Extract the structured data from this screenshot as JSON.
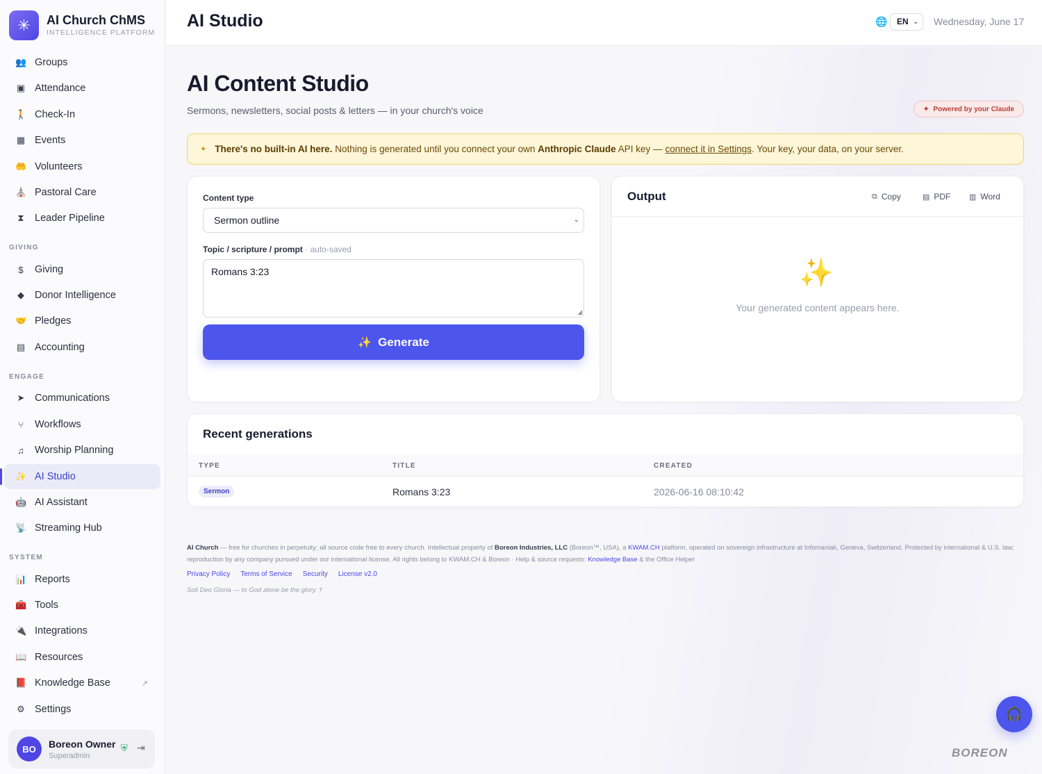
{
  "brand": {
    "name": "AI Church ChMS",
    "subtitle": "INTELLIGENCE PLATFORM"
  },
  "sidebar": {
    "items_top": [
      {
        "label": "Groups",
        "icon": "groups-icon"
      },
      {
        "label": "Attendance",
        "icon": "attendance-icon"
      },
      {
        "label": "Check-In",
        "icon": "check-in-icon"
      },
      {
        "label": "Events",
        "icon": "calendar-icon"
      },
      {
        "label": "Volunteers",
        "icon": "volunteers-icon"
      },
      {
        "label": "Pastoral Care",
        "icon": "pastoral-care-icon"
      },
      {
        "label": "Leader Pipeline",
        "icon": "leader-pipeline-icon"
      }
    ],
    "giving_label": "GIVING",
    "items_giving": [
      {
        "label": "Giving",
        "icon": "dollar-icon"
      },
      {
        "label": "Donor Intelligence",
        "icon": "gem-icon"
      },
      {
        "label": "Pledges",
        "icon": "handshake-icon"
      },
      {
        "label": "Accounting",
        "icon": "calculator-icon"
      }
    ],
    "engage_label": "ENGAGE",
    "items_engage": [
      {
        "label": "Communications",
        "icon": "send-icon"
      },
      {
        "label": "Workflows",
        "icon": "workflow-icon"
      },
      {
        "label": "Worship Planning",
        "icon": "music-icon"
      },
      {
        "label": "AI Studio",
        "icon": "magic-wand-icon"
      },
      {
        "label": "AI Assistant",
        "icon": "robot-icon"
      },
      {
        "label": "Streaming Hub",
        "icon": "broadcast-icon"
      }
    ],
    "system_label": "SYSTEM",
    "items_system": [
      {
        "label": "Reports",
        "icon": "chart-icon"
      },
      {
        "label": "Tools",
        "icon": "toolbox-icon"
      },
      {
        "label": "Integrations",
        "icon": "plug-icon"
      },
      {
        "label": "Resources",
        "icon": "book-icon"
      },
      {
        "label": "Knowledge Base",
        "icon": "knowledge-book-icon"
      },
      {
        "label": "Settings",
        "icon": "gear-icon"
      }
    ],
    "active": "AI Studio"
  },
  "user": {
    "initials": "BO",
    "name": "Boreon Owner",
    "role": "Superadmin"
  },
  "header": {
    "title": "AI Studio",
    "language": "EN",
    "date": "Wednesday, June 17"
  },
  "page": {
    "heading": "AI Content Studio",
    "subtitle": "Sermons, newsletters, social posts & letters — in your church's voice",
    "powered_badge": "Powered by your Claude"
  },
  "notice": {
    "bold_lead": "There's no built-in AI here.",
    "text_1": "Nothing is generated until you connect your own",
    "bold_mid": "Anthropic Claude",
    "text_2": "API key —",
    "link": "connect it in Settings",
    "text_3": ". Your key, your data, on your server."
  },
  "form": {
    "content_type_label": "Content type",
    "content_type_value": "Sermon outline",
    "prompt_label": "Topic / scripture / prompt",
    "prompt_hint": "· auto-saved",
    "prompt_value": "Romans 3:23",
    "generate_label": "Generate"
  },
  "output": {
    "title": "Output",
    "copy_label": "Copy",
    "pdf_label": "PDF",
    "word_label": "Word",
    "empty_text": "Your generated content appears here."
  },
  "recent": {
    "title": "Recent generations",
    "columns": [
      "TYPE",
      "TITLE",
      "CREATED"
    ],
    "rows": [
      {
        "type": "Sermon",
        "title": "Romans 3:23",
        "created": "2026-06-16 08:10:42"
      }
    ]
  },
  "footer": {
    "brand": "AI Church",
    "text_1": "— free for churches in perpetuity; all source code free to every church. Intellectual property of",
    "company": "Boreon Industries, LLC",
    "text_2": "(Boreon™, USA), a",
    "kwam": "KWAM.CH",
    "text_3": "platform, operated on sovereign infrastructure at Infomaniak, Geneva, Switzerland. Protected by international & U.S. law; reproduction by any company pursued under our international license. All rights belong to KWAM.CH & Boreon · Help & source requests:",
    "kb": "Knowledge Base",
    "text_4": "& the Office Helper",
    "links": [
      "Privacy Policy",
      "Terms of Service",
      "Security",
      "License v2.0"
    ],
    "motto": "Soli Deo Gloria — to God alone be the glory. †"
  },
  "watermark": "BOREON",
  "colors": {
    "accent": "#4c55ec",
    "notice_bg": "#fdf6d8",
    "notice_border": "#f1d36b",
    "badge_bg": "#fbeaea"
  }
}
